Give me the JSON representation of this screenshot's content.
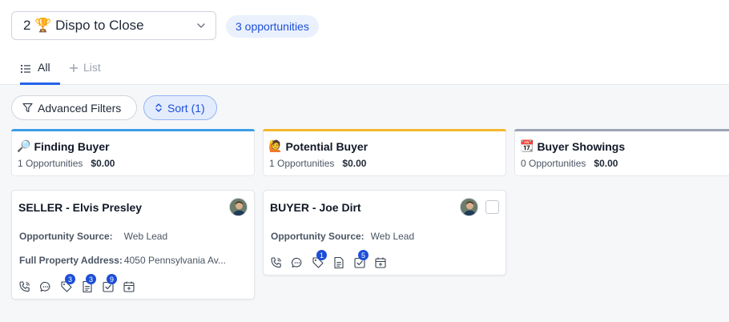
{
  "header": {
    "pipeline_select": {
      "label": "2 🏆 Dispo to Close"
    },
    "opportunity_count": "3 opportunities"
  },
  "tabs": [
    {
      "label": "All",
      "active": true
    },
    {
      "label": "List",
      "active": false
    }
  ],
  "toolbar": {
    "filters_label": "Advanced Filters",
    "sort_label": "Sort (1)"
  },
  "columns": [
    {
      "icon": "🔎",
      "title": "Finding Buyer",
      "count": "1 Opportunities",
      "amount": "$0.00",
      "accent": "#3b9ee6"
    },
    {
      "icon": "🙋",
      "title": "Potential Buyer",
      "count": "1 Opportunities",
      "amount": "$0.00",
      "accent": "#f5b82e"
    },
    {
      "icon": "📆",
      "title": "Buyer Showings",
      "count": "0 Opportunities",
      "amount": "$0.00",
      "accent": "#9ca3b5"
    }
  ],
  "cards": [
    {
      "name": "SELLER - Elvis Presley",
      "fields": [
        {
          "key": "Opportunity Source:",
          "value": "Web Lead"
        },
        {
          "key": "Full Property Address:",
          "value": "4050 Pennsylvania Av..."
        }
      ],
      "badges": {
        "tags": "3",
        "notes": "3",
        "tasks": "9"
      }
    },
    {
      "name": "BUYER - Joe Dirt",
      "fields": [
        {
          "key": "Opportunity Source:",
          "value": "Web Lead"
        }
      ],
      "badges": {
        "tags": "1",
        "tasks": "5"
      }
    }
  ],
  "icons": {
    "phone": "phone-icon",
    "chat": "chat-icon",
    "tag": "tag-icon",
    "note": "note-icon",
    "task": "task-icon",
    "calendar": "calendar-icon"
  },
  "colors": {
    "accent_blue": "#1d4ed8",
    "tab_underline": "#2563eb",
    "badge_bg": "#1d4ed8"
  }
}
